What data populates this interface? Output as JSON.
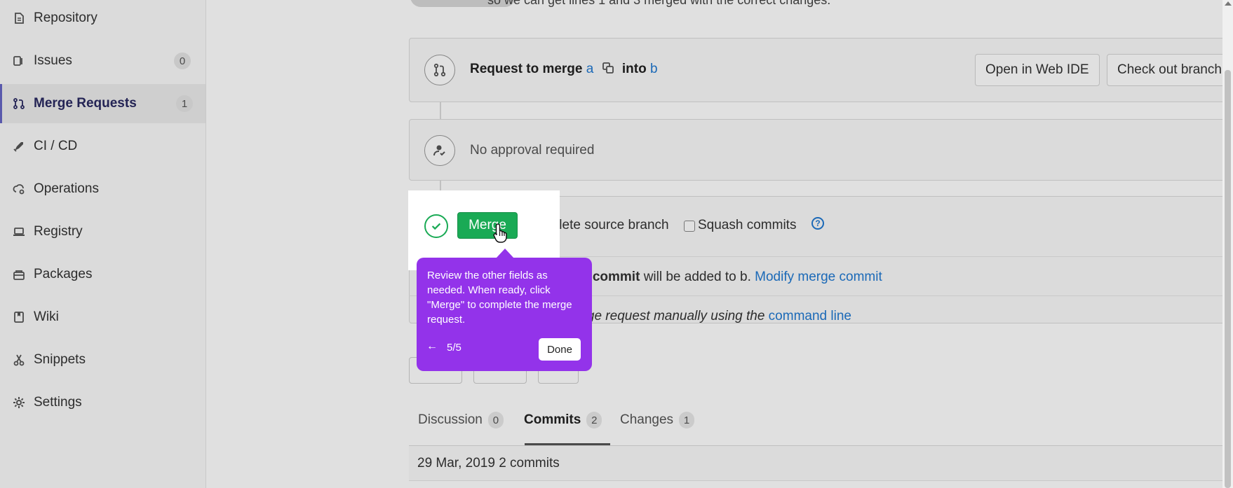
{
  "sidebar": {
    "items": [
      {
        "label": "Repository",
        "icon": "file-icon"
      },
      {
        "label": "Issues",
        "icon": "issues-icon",
        "count": "0"
      },
      {
        "label": "Merge Requests",
        "icon": "merge-request-icon",
        "count": "1",
        "active": true
      },
      {
        "label": "CI / CD",
        "icon": "rocket-icon"
      },
      {
        "label": "Operations",
        "icon": "cloud-gear-icon"
      },
      {
        "label": "Registry",
        "icon": "laptop-icon"
      },
      {
        "label": "Packages",
        "icon": "package-icon"
      },
      {
        "label": "Wiki",
        "icon": "book-icon"
      },
      {
        "label": "Snippets",
        "icon": "scissors-icon"
      },
      {
        "label": "Settings",
        "icon": "gear-icon"
      }
    ]
  },
  "top_text": "so we can get lines 1 and 3 merged with the correct changes.",
  "mr_widget": {
    "title_prefix": "Request to merge",
    "source_branch": "a",
    "into": "into",
    "target_branch": "b",
    "open_web_ide": "Open in Web IDE",
    "checkout_branch": "Check out branch"
  },
  "approval": {
    "text": "No approval required"
  },
  "merge_row": {
    "merge_button": "Merge",
    "delete_source_branch": "Delete source branch",
    "squash_commits": "Squash commits",
    "help": "?"
  },
  "merge_commit_line": {
    "prefix": "rge commit",
    "middle": " will be added to b. ",
    "link": "Modify merge commit"
  },
  "command_line": {
    "prefix": "erge request manually using the ",
    "link": "command line"
  },
  "tabs": [
    {
      "label": "Discussion",
      "count": "0"
    },
    {
      "label": "Commits",
      "count": "2",
      "active": true
    },
    {
      "label": "Changes",
      "count": "1"
    }
  ],
  "commits_header": "29 Mar, 2019 2 commits",
  "tooltip": {
    "text": "Review the other fields as needed. When ready, click \"Merge\" to complete the merge request.",
    "back": "←",
    "progress": "5/5",
    "done": "Done"
  },
  "colors": {
    "accent_purple": "#9333ea",
    "merge_green": "#1aaa55",
    "link_blue": "#1f78d1"
  }
}
